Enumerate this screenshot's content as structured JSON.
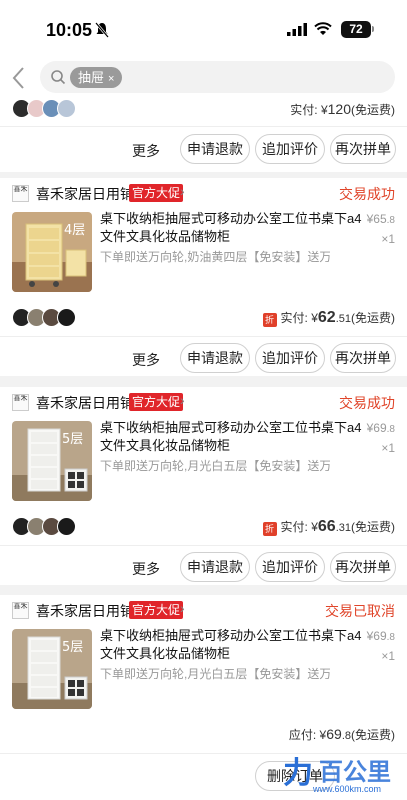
{
  "status_bar": {
    "time": "10:05",
    "battery": "72"
  },
  "search": {
    "query_chip": "抽屉",
    "chip_clear": "×"
  },
  "top_card": {
    "paid_label": "实付:",
    "currency": "¥",
    "amount": "120",
    "shipping": "(免运费)",
    "buttons": {
      "more": "更多",
      "refund": "申请退款",
      "review": "追加评价",
      "rebuy": "再次拼单"
    }
  },
  "orders": [
    {
      "shop_name": "喜禾家居日用铺",
      "badge": "官方大促",
      "status": "交易成功",
      "title": "桌下收纳柜抽屉式可移动办公室工位书桌下a4文件文具化妆品储物柜",
      "unit_price_int": "¥65",
      "unit_price_dec": ".8",
      "qty": "×1",
      "spec": "下单即送万向轮,奶油黄四层【免安装】送万向...",
      "thumb_label": "4层",
      "pay_tag": "折",
      "paid_label": "实付:",
      "currency": "¥",
      "amount_int": "62",
      "amount_dec": ".51",
      "shipping": "(免运费)",
      "buttons": {
        "more": "更多",
        "refund": "申请退款",
        "review": "追加评价",
        "rebuy": "再次拼单"
      }
    },
    {
      "shop_name": "喜禾家居日用铺",
      "badge": "官方大促",
      "status": "交易成功",
      "title": "桌下收纳柜抽屉式可移动办公室工位书桌下a4文件文具化妆品储物柜",
      "unit_price_int": "¥69",
      "unit_price_dec": ".8",
      "qty": "×1",
      "spec": "下单即送万向轮,月光白五层【免安装】送万向...",
      "thumb_label": "5层",
      "pay_tag": "折",
      "paid_label": "实付:",
      "currency": "¥",
      "amount_int": "66",
      "amount_dec": ".31",
      "shipping": "(免运费)",
      "buttons": {
        "more": "更多",
        "refund": "申请退款",
        "review": "追加评价",
        "rebuy": "再次拼单"
      }
    },
    {
      "shop_name": "喜禾家居日用铺",
      "badge": "官方大促",
      "status": "交易已取消",
      "title": "桌下收纳柜抽屉式可移动办公室工位书桌下a4文件文具化妆品储物柜",
      "unit_price_int": "¥69",
      "unit_price_dec": ".8",
      "qty": "×1",
      "spec": "下单即送万向轮,月光白五层【免安装】送万向...",
      "thumb_label": "5层",
      "paid_label": "应付:",
      "currency": "¥",
      "amount_int": "69",
      "amount_dec": ".8",
      "shipping": "(免运费)",
      "buttons": {
        "delete": "删除订单"
      }
    }
  ],
  "watermark": {
    "brand": "百公里",
    "url": "www.600km.com"
  },
  "colors": {
    "accent_red": "#e0252a",
    "status_orange": "#e0452a",
    "watermark_blue": "#2a6fd6"
  }
}
